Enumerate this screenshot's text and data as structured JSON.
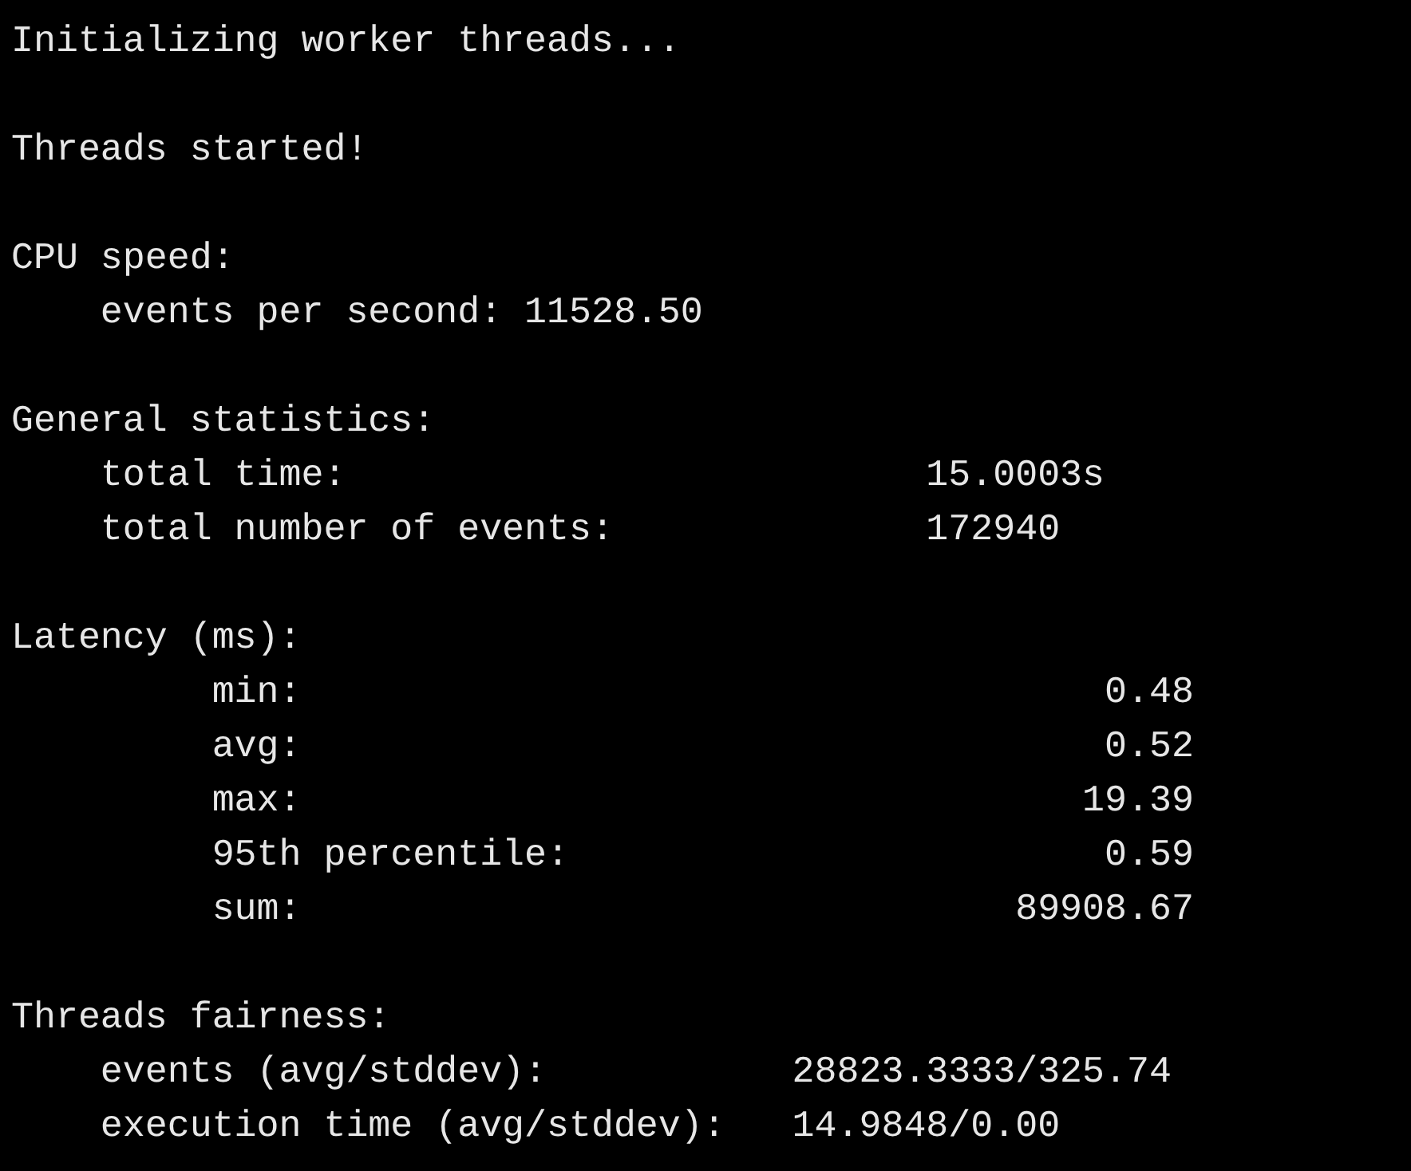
{
  "messages": [
    "Initializing worker threads...",
    "Threads started!"
  ],
  "sections": [
    {
      "kind": "inline",
      "heading": "CPU speed:",
      "items": [
        {
          "label": "events per second:",
          "value": "11528.50"
        }
      ]
    },
    {
      "kind": "wide",
      "heading": "General statistics:",
      "items": [
        {
          "label": "total time:",
          "value": "15.0003s"
        },
        {
          "label": "total number of events:",
          "value": "172940"
        }
      ]
    },
    {
      "kind": "nested",
      "heading": "Latency (ms):",
      "items": [
        {
          "label": "min:",
          "value": "0.48"
        },
        {
          "label": "avg:",
          "value": "0.52"
        },
        {
          "label": "max:",
          "value": "19.39"
        },
        {
          "label": "95th percentile:",
          "value": "0.59"
        },
        {
          "label": "sum:",
          "value": "89908.67"
        }
      ]
    },
    {
      "kind": "mid",
      "heading": "Threads fairness:",
      "items": [
        {
          "label": "events (avg/stddev):",
          "value": "28823.3333/325.74"
        },
        {
          "label": "execution time (avg/stddev):",
          "value": "14.9848/0.00"
        }
      ]
    }
  ]
}
